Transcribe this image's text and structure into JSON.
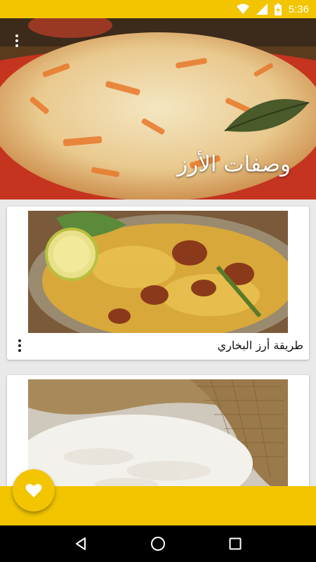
{
  "status_bar": {
    "time": "5:36",
    "icons": [
      "wifi-icon",
      "signal-icon",
      "battery-charging-icon"
    ],
    "color": "#f2c500"
  },
  "header": {
    "title": "وصفات الأرز",
    "menu_icon": "overflow-menu-icon",
    "image": "rice-with-carrots-photo"
  },
  "recipes": [
    {
      "title": "طريقة أرز البخاري",
      "image": "bukhari-rice-platter-photo",
      "menu_icon": "overflow-menu-icon"
    },
    {
      "title": "",
      "image": "rice-sack-photo",
      "menu_icon": "overflow-menu-icon"
    }
  ],
  "fab": {
    "icon": "heart-icon",
    "color": "#f2c500"
  },
  "nav_bar": {
    "buttons": [
      "back-triangle-icon",
      "home-circle-icon",
      "recents-square-icon"
    ]
  },
  "colors": {
    "accent": "#f2c500",
    "card_bg": "#ffffff",
    "page_bg": "#e9e9e9"
  }
}
